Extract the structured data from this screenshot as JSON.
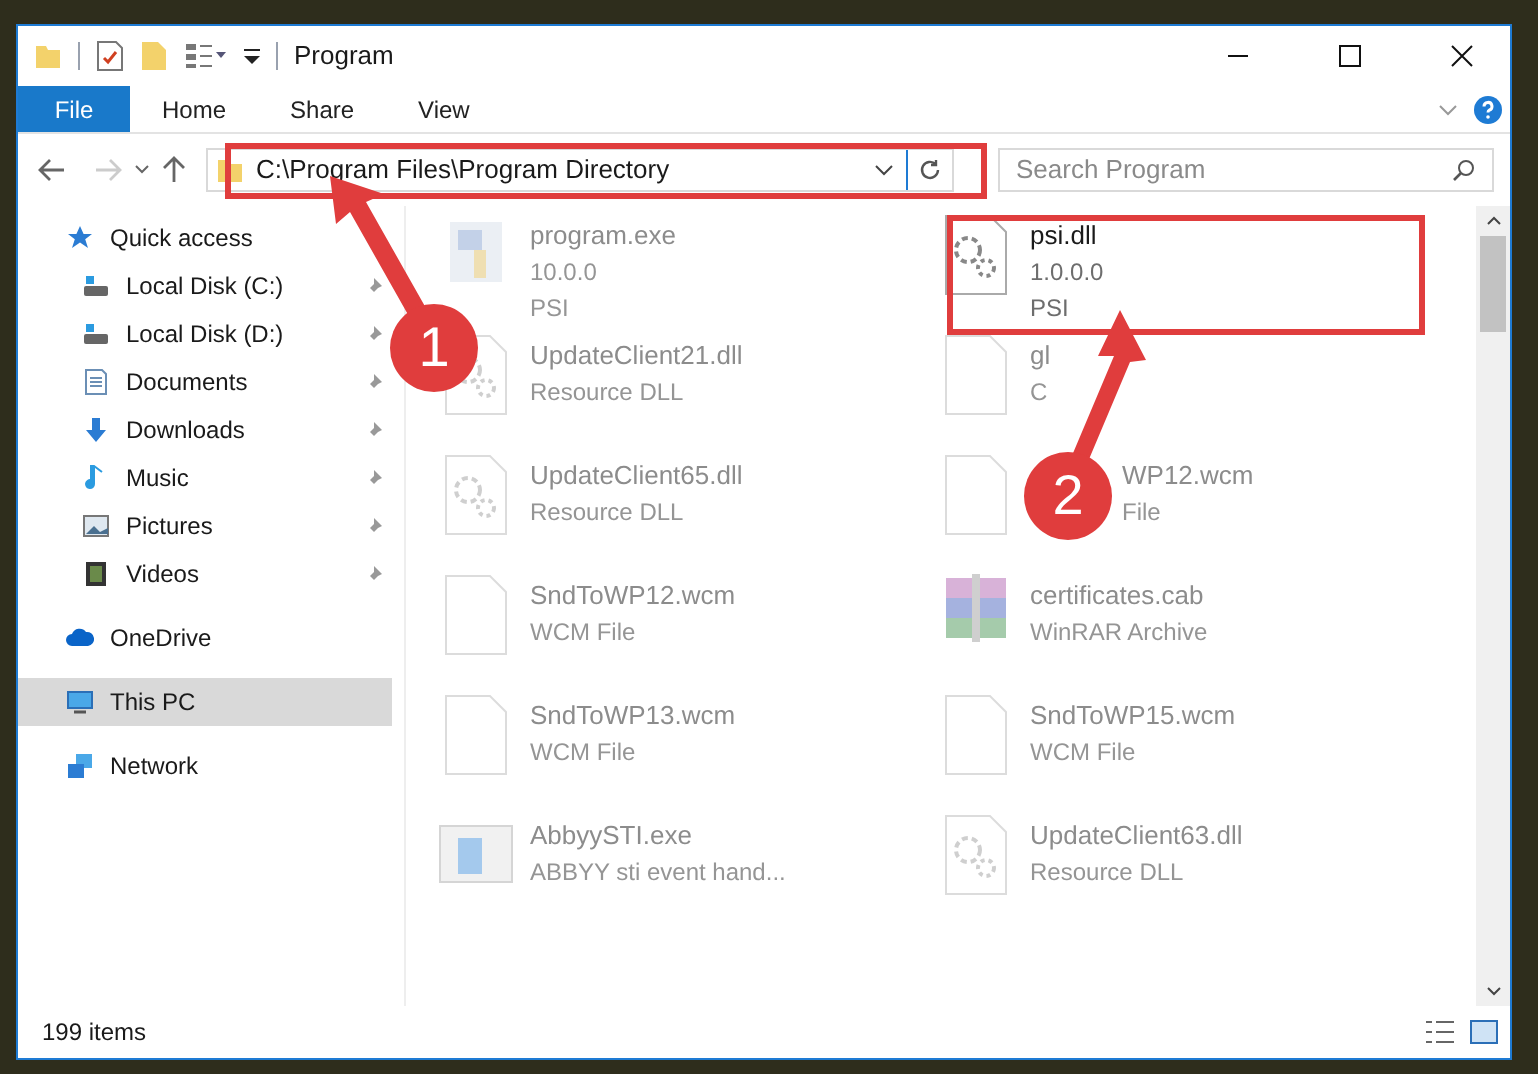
{
  "window": {
    "title": "Program"
  },
  "ribbon_tabs": [
    {
      "label": "File",
      "selected": true
    },
    {
      "label": "Home",
      "selected": false
    },
    {
      "label": "Share",
      "selected": false
    },
    {
      "label": "View",
      "selected": false
    }
  ],
  "address_bar": {
    "path": "C:\\Program Files\\Program Directory"
  },
  "search": {
    "placeholder": "Search Program"
  },
  "sidebar": {
    "items": [
      {
        "label": "Quick access",
        "kind": "star",
        "selected": false,
        "children": [
          {
            "label": "Local Disk (C:)",
            "kind": "drive",
            "pinned": true,
            "selected": false
          },
          {
            "label": "Local Disk (D:)",
            "kind": "drive",
            "pinned": true,
            "selected": false
          },
          {
            "label": "Documents",
            "kind": "document",
            "pinned": true,
            "selected": false
          },
          {
            "label": "Downloads",
            "kind": "download",
            "pinned": true,
            "selected": false
          },
          {
            "label": "Music",
            "kind": "music",
            "pinned": true,
            "selected": false
          },
          {
            "label": "Pictures",
            "kind": "picture",
            "pinned": true,
            "selected": false
          },
          {
            "label": "Videos",
            "kind": "film",
            "pinned": true,
            "selected": false
          }
        ]
      },
      {
        "label": "OneDrive",
        "kind": "cloud",
        "selected": false
      },
      {
        "label": "This PC",
        "kind": "monitor",
        "selected": true
      },
      {
        "label": "Network",
        "kind": "network",
        "selected": false
      }
    ]
  },
  "files": [
    {
      "name": "program.exe",
      "lines": [
        "10.0.0",
        "PSI"
      ],
      "kind": "app",
      "dimmed": true
    },
    {
      "name": "psi.dll",
      "lines": [
        "1.0.0.0",
        "PSI"
      ],
      "kind": "gear",
      "dimmed": false
    },
    {
      "name": "UpdateClient21.dll",
      "lines": [
        "Resource DLL"
      ],
      "kind": "gear",
      "dimmed": true
    },
    {
      "name": "gl",
      "lines": [
        "C"
      ],
      "kind": "blank",
      "dimmed": true
    },
    {
      "name": "UpdateClient65.dll",
      "lines": [
        "Resource DLL"
      ],
      "kind": "gear",
      "dimmed": true
    },
    {
      "name": "WP12.wcm",
      "lines": [
        "File"
      ],
      "kind": "blank",
      "dimmed": true
    },
    {
      "name": "SndToWP12.wcm",
      "lines": [
        "WCM File"
      ],
      "kind": "blank",
      "dimmed": true
    },
    {
      "name": "certificates.cab",
      "lines": [
        "WinRAR Archive"
      ],
      "kind": "archive",
      "dimmed": true
    },
    {
      "name": "SndToWP13.wcm",
      "lines": [
        "WCM File"
      ],
      "kind": "blank",
      "dimmed": true
    },
    {
      "name": "SndToWP15.wcm",
      "lines": [
        "WCM File"
      ],
      "kind": "blank",
      "dimmed": true
    },
    {
      "name": "AbbyySTI.exe",
      "lines": [
        "ABBYY sti event hand..."
      ],
      "kind": "window",
      "dimmed": true
    },
    {
      "name": "UpdateClient63.dll",
      "lines": [
        "Resource DLL"
      ],
      "kind": "gear",
      "dimmed": true
    }
  ],
  "status_bar": {
    "item_count": "199 items"
  },
  "callouts": [
    {
      "label": "1"
    },
    {
      "label": "2"
    }
  ]
}
